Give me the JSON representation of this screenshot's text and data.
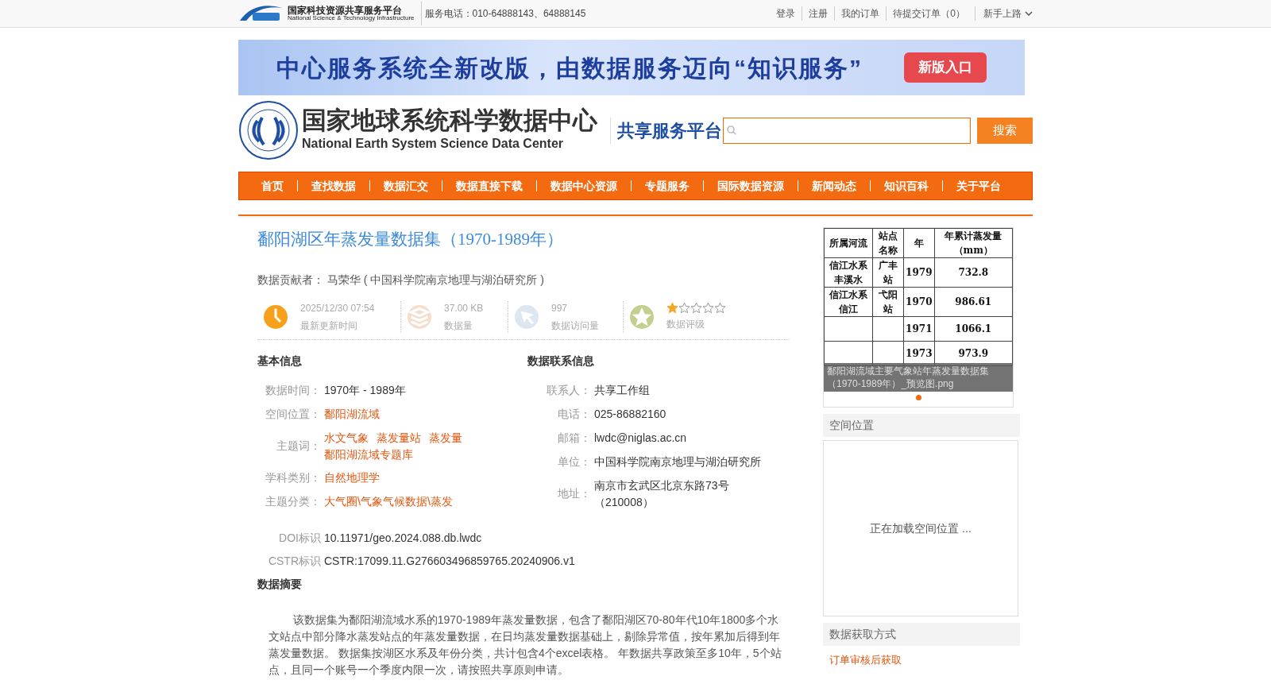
{
  "top_bar": {
    "logo_cn": "国家科技资源共享服务平台",
    "logo_en": "National Science & Technology Infrastructure",
    "phone": "服务电话：010-64888143、64888145",
    "links": [
      "登录",
      "注册",
      "我的订单",
      "待提交订单（0）"
    ],
    "guide": "新手上路"
  },
  "banner": {
    "text": "中心服务系统全新改版，由数据服务迈向“知识服务”",
    "button": "新版入口"
  },
  "header": {
    "title_cn": "国家地球系统科学数据中心",
    "title_en": "National Earth System Science Data Center",
    "subtitle": "共享服务平台",
    "search_button": "搜索"
  },
  "nav": [
    "首页",
    "查找数据",
    "数据汇交",
    "数据直接下载",
    "数据中心资源",
    "专题服务",
    "国际数据资源",
    "新闻动态",
    "知识百科",
    "关于平台"
  ],
  "dataset": {
    "title": "鄱阳湖区年蒸发量数据集（1970-1989年）",
    "contributor_label": "数据贡献者：",
    "contributor": "马荣华 ( 中国科学院南京地理与湖泊研究所 )"
  },
  "stats": [
    {
      "kind": "clock",
      "value": "2025/12/30 07:54",
      "label": "最新更新时间"
    },
    {
      "kind": "size",
      "value": "37.00 KB",
      "label": "数据量"
    },
    {
      "kind": "visits",
      "value": "997",
      "label": "数据访问量"
    },
    {
      "kind": "rating",
      "stars": 1,
      "label": "数据评级"
    }
  ],
  "basic_info": {
    "heading": "基本信息",
    "rows": [
      {
        "label": "数据时间：",
        "kind": "text",
        "values": [
          "1970年 - 1989年"
        ]
      },
      {
        "label": "空间位置：",
        "kind": "link",
        "values": [
          "鄱阳湖流域"
        ]
      },
      {
        "label": "主题词：",
        "kind": "link",
        "values": [
          "水文气象",
          "蒸发量站",
          "蒸发量",
          "鄱阳湖流域专题库"
        ]
      },
      {
        "label": "学科类别：",
        "kind": "link",
        "values": [
          "自然地理学"
        ]
      },
      {
        "label": "主题分类：",
        "kind": "link",
        "values": [
          "大气圈\\气象气候数据\\蒸发"
        ]
      }
    ]
  },
  "contact_info": {
    "heading": "数据联系信息",
    "rows": [
      {
        "label": "联系人：",
        "value": "共享工作组"
      },
      {
        "label": "电话：",
        "value": "025-86882160"
      },
      {
        "label": "邮箱：",
        "value": "lwdc@niglas.ac.cn"
      },
      {
        "label": "单位：",
        "value": "中国科学院南京地理与湖泊研究所"
      },
      {
        "label": "地址：",
        "value": "南京市玄武区北京东路73号（210008）"
      }
    ]
  },
  "identifiers": [
    {
      "label": "DOI标识",
      "value": "10.11971/geo.2024.088.db.lwdc"
    },
    {
      "label": "CSTR标识",
      "value": "CSTR:17099.11.G276603496859765.20240906.v1"
    }
  ],
  "abstract": {
    "heading": "数据摘要",
    "text": "该数据集为鄱阳湖流域水系的1970-1989年蒸发量数据，包含了鄱阳湖区70-80年代10年1800多个水文站点中部分降水蒸发站点的年蒸发量数据，在日均蒸发量数据基础上，剔除异常值，按年累加后得到年蒸发量数据。 数据集按湖区水系及年份分类，共计包含4个excel表格。 年数据共享政策至多10年，5个站点，且同一个账号一个季度内限一次，请按照共享原则申请。"
  },
  "preview": {
    "table": {
      "columns": [
        "所属河流",
        "站点名称",
        "年",
        "年累计蒸发量（mm）"
      ],
      "rows": [
        [
          "信江水系丰溪水",
          "广丰站",
          "1979",
          "732.8"
        ],
        [
          "信江水系信江",
          "弋阳站",
          "1970",
          "986.61"
        ],
        [
          "",
          "",
          "1971",
          "1066.1"
        ],
        [
          "",
          "",
          "1973",
          "973.9"
        ]
      ]
    },
    "caption": "鄱阳湖流域主要气象站年蒸发量数据集（1970-1989年）_预览图.png",
    "dots": [
      {
        "selected": true
      }
    ]
  },
  "sidebar": [
    {
      "heading": "空间位置",
      "kind": "map",
      "text": "正在加载空间位置 ..."
    },
    {
      "heading": "数据获取方式",
      "kind": "link",
      "text": "订单审核后获取"
    }
  ]
}
